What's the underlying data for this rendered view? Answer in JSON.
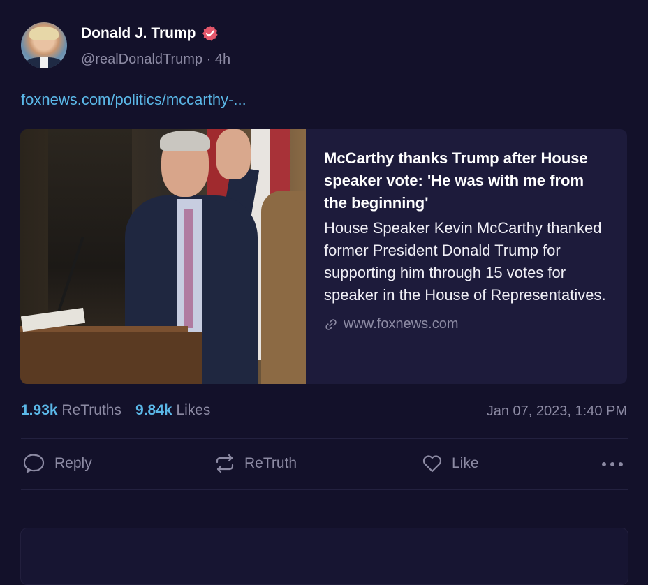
{
  "author": {
    "name": "Donald J. Trump",
    "handle_time": "@realDonaldTrump · 4h"
  },
  "post": {
    "link_text": "foxnews.com/politics/mccarthy-..."
  },
  "card": {
    "title": "McCarthy thanks Trump after House speaker vote: 'He was with me from the beginning'",
    "description": "House Speaker Kevin McCarthy thanked former President Donald Trump for supporting him through 15 votes for speaker in the House of Representatives.",
    "domain": "www.foxnews.com"
  },
  "stats": {
    "retruths_count": "1.93k",
    "retruths_label": "ReTruths",
    "likes_count": "9.84k",
    "likes_label": "Likes",
    "timestamp": "Jan 07, 2023, 1:40 PM"
  },
  "actions": {
    "reply": "Reply",
    "retruth": "ReTruth",
    "like": "Like"
  },
  "colors": {
    "background": "#13112a",
    "accent": "#5bb8e8",
    "verified": "#e4576b",
    "muted": "#8c8aa3"
  },
  "icons": [
    "avatar",
    "verified-badge-icon",
    "link-icon",
    "reply-icon",
    "retruth-icon",
    "like-icon",
    "more-icon"
  ]
}
